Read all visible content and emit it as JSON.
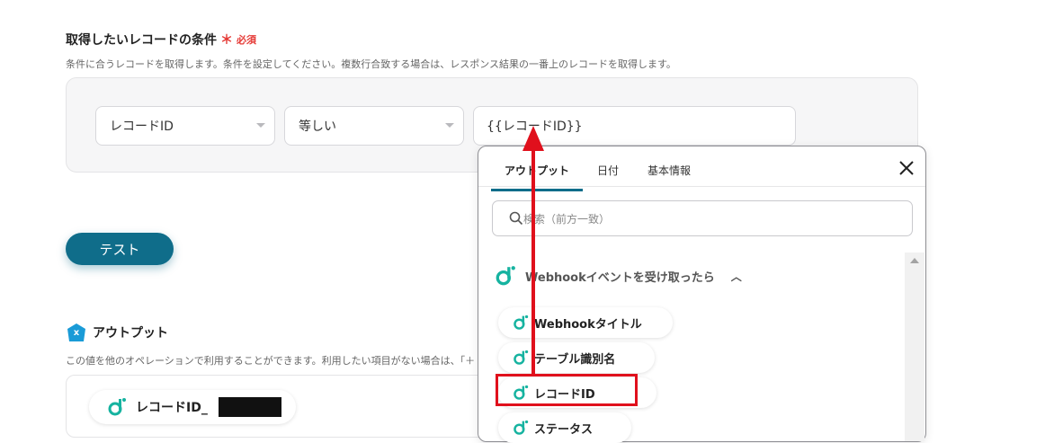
{
  "conditions": {
    "title": "取得したいレコードの条件",
    "required_mark": "＊",
    "required_text": "必須",
    "description": "条件に合うレコードを取得します。条件を設定してください。複数行合致する場合は、レスポンス結果の一番上のレコードを取得します。",
    "field_select": "レコードID",
    "operator_select": "等しい",
    "value_input": "{{レコードID}}"
  },
  "test_button": "テスト",
  "output": {
    "title": "アウトプット",
    "badge": "x",
    "description": "この値を他のオペレーションで利用することができます。利用したい項目がない場合は、「＋",
    "chip_label": "レコードID_"
  },
  "popup": {
    "tabs": [
      "アウトプット",
      "日付",
      "基本情報"
    ],
    "search_placeholder": "検索（前方一致）",
    "group_label": "Webhookイベントを受け取ったら",
    "items": [
      "Webhookタイトル",
      "テーブル識別名",
      "レコードID",
      "ステータス"
    ]
  },
  "colors": {
    "accent": "#0f6d8a",
    "annotation_red": "#e0101c",
    "logo_teal": "#16b3a0"
  }
}
